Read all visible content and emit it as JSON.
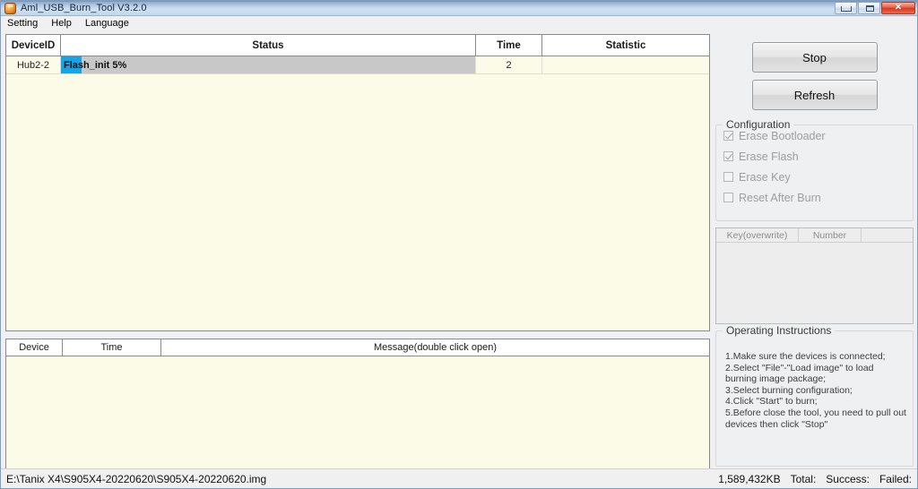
{
  "window": {
    "title": "Aml_USB_Burn_Tool V3.2.0",
    "icon": "app-icon",
    "minimize_label": "",
    "maximize_label": "",
    "close_label": "✕"
  },
  "menu": {
    "items": [
      {
        "label": "Setting"
      },
      {
        "label": "Help"
      },
      {
        "label": "Language"
      }
    ]
  },
  "device_table": {
    "columns": [
      "DeviceID",
      "Status",
      "Time",
      "Statistic"
    ],
    "rows": [
      {
        "device_id": "Hub2-2",
        "status_text": "Flash_init 5%",
        "progress_percent": 5,
        "time": "2",
        "statistic": ""
      }
    ]
  },
  "message_table": {
    "columns": [
      "Device",
      "Time",
      "Message(double click open)"
    ],
    "rows": []
  },
  "right_panel": {
    "stop_label": "Stop",
    "refresh_label": "Refresh",
    "configuration": {
      "title": "Configuration",
      "options": [
        {
          "label": "Erase Bootloader",
          "checked": true,
          "enabled": false
        },
        {
          "label": "Erase Flash",
          "checked": true,
          "enabled": false
        },
        {
          "label": "Erase Key",
          "checked": false,
          "enabled": false
        },
        {
          "label": "Reset After Burn",
          "checked": false,
          "enabled": false
        }
      ]
    },
    "key_grid": {
      "columns": [
        "Key(overwrite)",
        "Number",
        ""
      ],
      "rows": []
    },
    "instructions": {
      "title": "Operating Instructions",
      "lines": [
        "1.Make sure the devices is connected;",
        "2.Select \"File\"-\"Load image\" to load burning image package;",
        "3.Select burning configuration;",
        "4.Click \"Start\" to burn;",
        "5.Before close the tool, you need to pull out devices then click \"Stop\""
      ]
    }
  },
  "statusbar": {
    "image_path": "E:\\Tanix X4\\S905X4-20220620\\S905X4-20220620.img",
    "size_label": "1,589,432KB",
    "total_label": "Total:",
    "success_label": "Success:",
    "failed_label": "Failed:"
  },
  "colors": {
    "progress_fill": "#14a5e6",
    "progress_track": "#c8c8c8",
    "table_background": "#fbfbe8",
    "titlebar_accent": "#b9cde4",
    "close_button": "#d23a21"
  }
}
